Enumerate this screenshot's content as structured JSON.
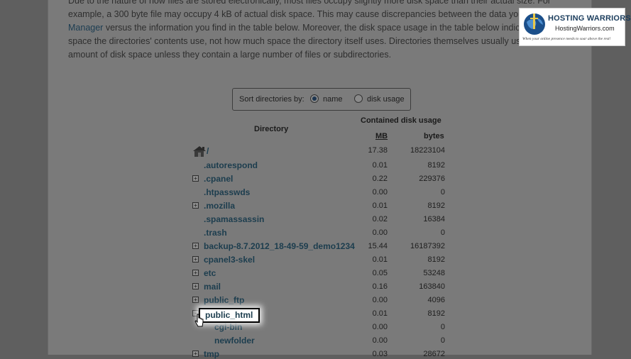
{
  "intro": {
    "line1": "Due to the nature of how files are stored electronically, most files occupy slightly more disk space than their actual size. For",
    "line2": "example, a 300 byte file may occupy 4 kB of actual disk space. This may cause discrepancies between the data you see in File",
    "line3_link": "Manager",
    "line3_rest": " versus the information you find in the table below. Moreover, the disk space usage in the table below indicates how much",
    "line4": "space the directories' contents use, not how much space the directory itself uses. Directories themselves usually use a negligible",
    "line5": "amount of disk space unless they contain a large number of files or subdirectories."
  },
  "sort": {
    "label": "Sort directories by:",
    "options": [
      "name",
      "disk usage"
    ],
    "selected": "name"
  },
  "table": {
    "directory_header": "Directory",
    "contained_header": "Contained disk usage",
    "mb_header": "MB",
    "bytes_header": "bytes",
    "root": {
      "name": "/",
      "mb": "17.38",
      "bytes": "18223104",
      "icon": "home-icon"
    },
    "rows": [
      {
        "name": ".autorespond",
        "mb": "0.01",
        "bytes": "8192",
        "expandable": false
      },
      {
        "name": ".cpanel",
        "mb": "0.22",
        "bytes": "229376",
        "expandable": true
      },
      {
        "name": ".htpasswds",
        "mb": "0.00",
        "bytes": "0",
        "expandable": false
      },
      {
        "name": ".mozilla",
        "mb": "0.01",
        "bytes": "8192",
        "expandable": true
      },
      {
        "name": ".spamassassin",
        "mb": "0.02",
        "bytes": "16384",
        "expandable": false
      },
      {
        "name": ".trash",
        "mb": "0.00",
        "bytes": "0",
        "expandable": false
      },
      {
        "name": "backup-8.7.2012_18-49-59_demo1234",
        "mb": "15.44",
        "bytes": "16187392",
        "expandable": true
      },
      {
        "name": "cpanel3-skel",
        "mb": "0.01",
        "bytes": "8192",
        "expandable": true
      },
      {
        "name": "etc",
        "mb": "0.05",
        "bytes": "53248",
        "expandable": true
      },
      {
        "name": "mail",
        "mb": "0.16",
        "bytes": "163840",
        "expandable": true
      },
      {
        "name": "public_ftp",
        "mb": "0.00",
        "bytes": "4096",
        "expandable": true
      },
      {
        "name": "public_html",
        "mb": "0.01",
        "bytes": "8192",
        "expandable": true,
        "highlighted": true
      },
      {
        "name": "cgi-bin",
        "mb": "0.00",
        "bytes": "0",
        "expandable": false,
        "child": true
      },
      {
        "name": "newfolder",
        "mb": "0.00",
        "bytes": "0",
        "expandable": false,
        "child": true
      },
      {
        "name": "tmp",
        "mb": "0.03",
        "bytes": "28672",
        "expandable": true
      }
    ]
  },
  "logo": {
    "title": "HOSTING WARRIORS",
    "url": "HostingWarriors.com",
    "tagline": "When your online presence needs to soar above the rest!"
  },
  "colors": {
    "link": "#1c3d4e",
    "overlay_bg": "#7a7a7a",
    "highlight_border": "#000000"
  }
}
